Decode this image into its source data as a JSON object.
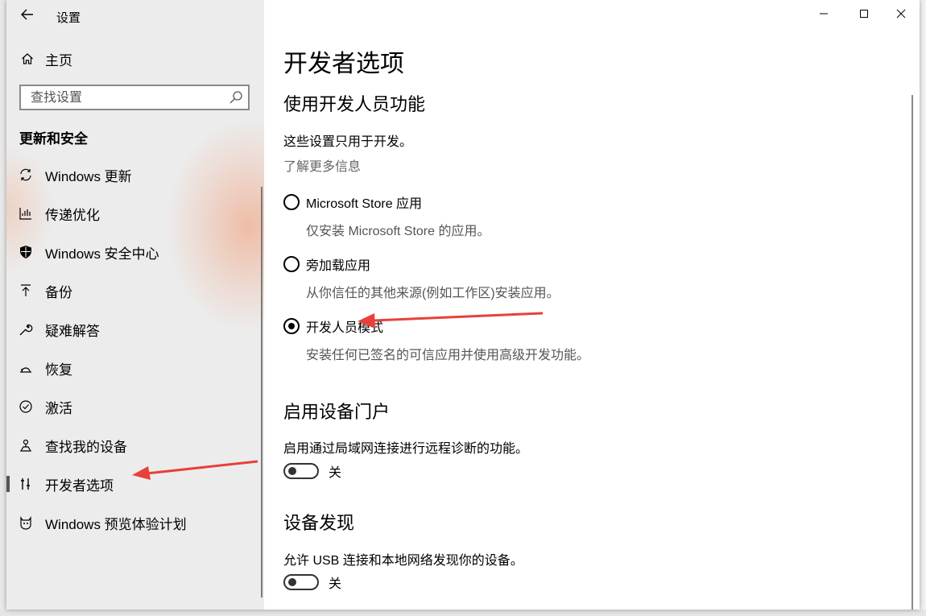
{
  "window": {
    "title": "设置"
  },
  "sidebar": {
    "home_label": "主页",
    "search_placeholder": "查找设置",
    "section_title": "更新和安全",
    "items": [
      {
        "label": "Windows 更新",
        "icon": "sync-icon"
      },
      {
        "label": "传递优化",
        "icon": "delivery-optimization-icon"
      },
      {
        "label": "Windows 安全中心",
        "icon": "shield-icon"
      },
      {
        "label": "备份",
        "icon": "backup-icon"
      },
      {
        "label": "疑难解答",
        "icon": "wrench-icon"
      },
      {
        "label": "恢复",
        "icon": "recovery-icon"
      },
      {
        "label": "激活",
        "icon": "check-circle-icon"
      },
      {
        "label": "查找我的设备",
        "icon": "find-device-icon"
      },
      {
        "label": "开发者选项",
        "icon": "developer-tools-icon",
        "selected": true
      },
      {
        "label": "Windows 预览体验计划",
        "icon": "insider-cat-icon"
      }
    ]
  },
  "main": {
    "page_title": "开发者选项",
    "dev_features": {
      "heading": "使用开发人员功能",
      "intro": "这些设置只用于开发。",
      "learn_more": "了解更多信息",
      "options": [
        {
          "label": "Microsoft Store 应用",
          "description": "仅安装 Microsoft Store 的应用。",
          "checked": false
        },
        {
          "label": "旁加载应用",
          "description": "从你信任的其他来源(例如工作区)安装应用。",
          "checked": false
        },
        {
          "label": "开发人员模式",
          "description": "安装任何已签名的可信应用并使用高级开发功能。",
          "checked": true
        }
      ]
    },
    "device_portal": {
      "heading": "启用设备门户",
      "description": "启用通过局域网连接进行远程诊断的功能。",
      "toggle_state": "关",
      "toggle_on": false
    },
    "device_discovery": {
      "heading": "设备发现",
      "description": "允许 USB 连接和本地网络发现你的设备。",
      "toggle_state": "关",
      "toggle_on": false
    }
  },
  "colors": {
    "annotation_arrow": "#e8403a",
    "sidebar_accent_glow": "#f0a07a"
  }
}
